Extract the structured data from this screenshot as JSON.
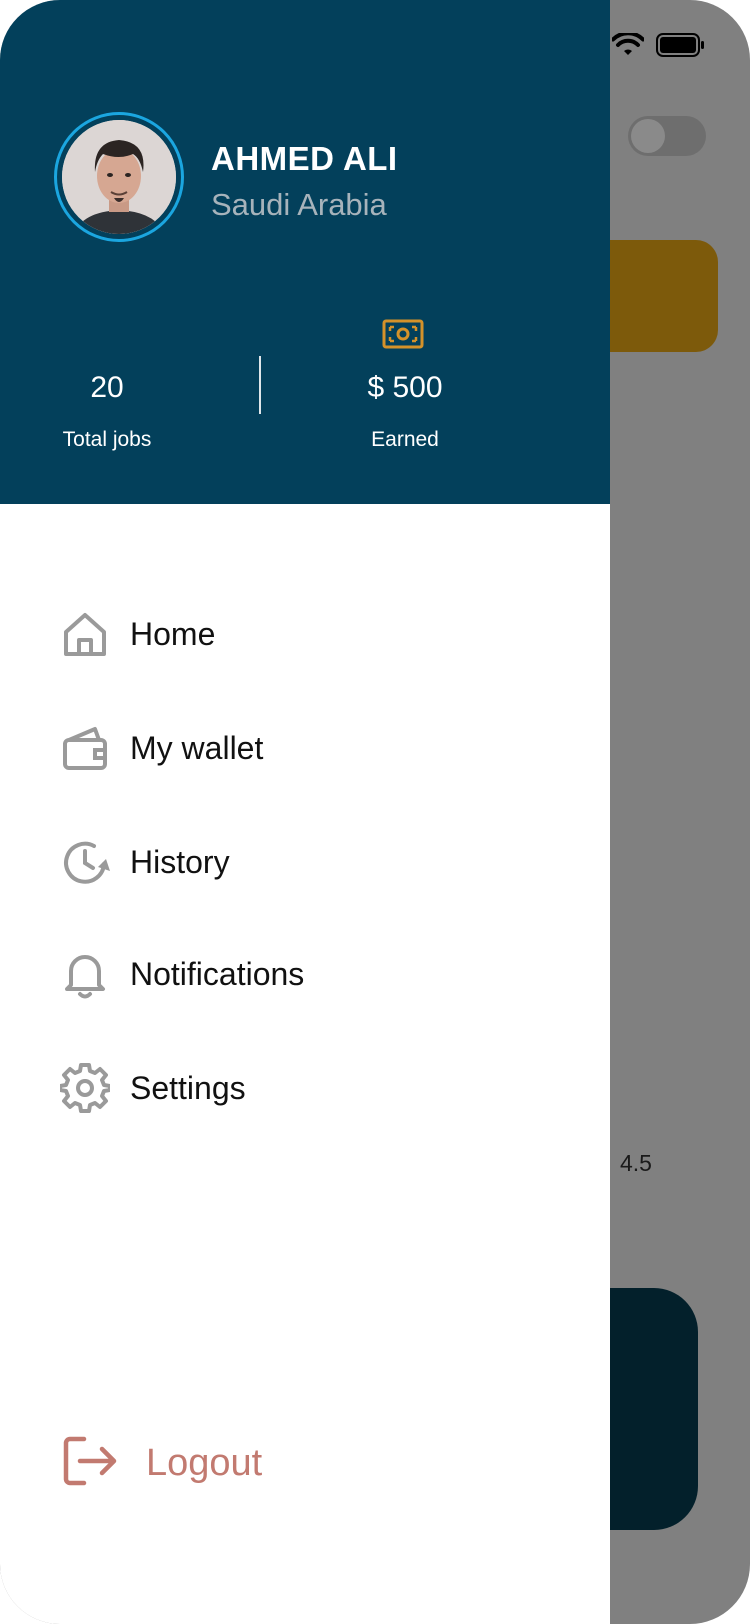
{
  "background": {
    "rating": "4.5"
  },
  "profile": {
    "name": "AHMED ALI",
    "country": "Saudi Arabia",
    "avatar_icon": "user-avatar-photo"
  },
  "stats": {
    "jobs_value": "20",
    "jobs_label": "Total jobs",
    "earned_value": "$ 500",
    "earned_label": "Earned",
    "earned_icon": "money-icon"
  },
  "menu": {
    "items": [
      {
        "label": "Home",
        "icon": "home-icon"
      },
      {
        "label": "My wallet",
        "icon": "wallet-icon"
      },
      {
        "label": "History",
        "icon": "history-icon"
      },
      {
        "label": "Notifications",
        "icon": "bell-icon"
      },
      {
        "label": "Settings",
        "icon": "gear-icon"
      }
    ]
  },
  "logout": {
    "label": "Logout",
    "icon": "logout-icon"
  },
  "colors": {
    "header_bg": "#03405b",
    "avatar_ring": "#1ba6e0",
    "money_accent": "#d4922a",
    "logout": "#c27a70",
    "menu_icon": "#9a9a9a",
    "overlay": "#808080"
  }
}
